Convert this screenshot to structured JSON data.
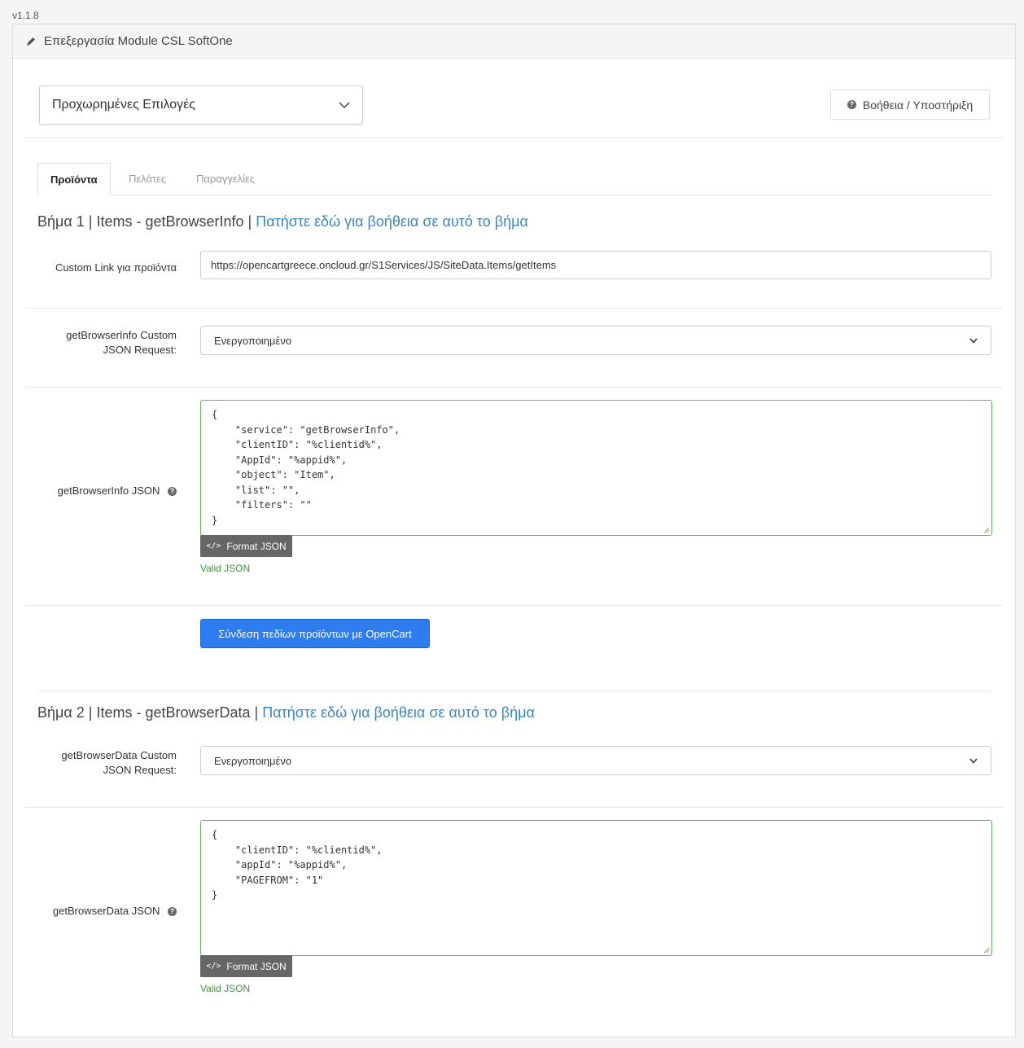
{
  "version": "v1.1.8",
  "header": {
    "title": "Επεξεργασία Module CSL SoftOne",
    "icon": "pencil-icon"
  },
  "advanced_select": {
    "value": "Προχωρημένες Επιλογές"
  },
  "help_button": {
    "label": "Βοήθεια / Υποστήριξη",
    "icon": "question-circle-icon"
  },
  "tabs": [
    {
      "label": "Προϊόντα",
      "active": true
    },
    {
      "label": "Πελάτες",
      "active": false
    },
    {
      "label": "Παραγγελίες",
      "active": false
    }
  ],
  "step1": {
    "title": "Βήμα 1 | Items - getBrowserInfo |",
    "help_link": "Πατήστε εδώ για βοήθεια σε αυτό το βήμα",
    "custom_link_label": "Custom Link για προϊόντα",
    "custom_link_value": "https://opencartgreece.oncloud.gr/S1Services/JS/SiteData.Items/getItems",
    "custom_request_label": "getBrowserInfo Custom JSON Request:",
    "custom_request_value": "Ενεργοποιημένο",
    "json_label": "getBrowserInfo JSON",
    "json_value": "{\n    \"service\": \"getBrowserInfo\",\n    \"clientID\": \"%clientid%\",\n    \"AppId\": \"%appid%\",\n    \"object\": \"Item\",\n    \"list\": \"\",\n    \"filters\": \"\"\n}",
    "format_button": "Format JSON",
    "valid_text": "Valid JSON",
    "map_button": "Σύνδεση πεδίων προϊόντων με OpenCart"
  },
  "step2": {
    "title": "Βήμα 2 | Items - getBrowserData |",
    "help_link": "Πατήστε εδώ για βοήθεια σε αυτό το βήμα",
    "custom_request_label": "getBrowserData Custom JSON Request:",
    "custom_request_value": "Ενεργοποιημένο",
    "json_label": "getBrowserData JSON",
    "json_value": "{\n    \"clientID\": \"%clientid%\",\n    \"appId\": \"%appid%\",\n    \"PAGEFROM\": \"1\"\n}",
    "format_button": "Format JSON",
    "valid_text": "Valid JSON"
  }
}
